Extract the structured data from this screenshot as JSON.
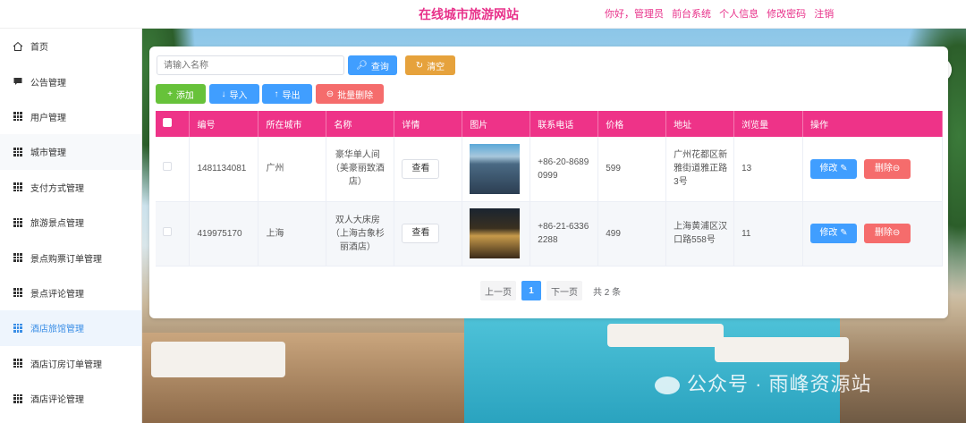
{
  "header": {
    "title": "在线城市旅游网站",
    "greeting": "你好，管理员",
    "links": [
      "前台系统",
      "个人信息",
      "修改密码",
      "注销"
    ]
  },
  "sidebar": {
    "items": [
      {
        "label": "首页",
        "icon": "home-icon"
      },
      {
        "label": "公告管理",
        "icon": "message-icon"
      },
      {
        "label": "用户管理",
        "icon": "grid-icon"
      },
      {
        "label": "城市管理",
        "icon": "grid-icon"
      },
      {
        "label": "支付方式管理",
        "icon": "grid-icon"
      },
      {
        "label": "旅游景点管理",
        "icon": "grid-icon"
      },
      {
        "label": "景点购票订单管理",
        "icon": "grid-icon"
      },
      {
        "label": "景点评论管理",
        "icon": "grid-icon"
      },
      {
        "label": "酒店旅馆管理",
        "icon": "grid-icon",
        "active": true
      },
      {
        "label": "酒店订房订单管理",
        "icon": "grid-icon"
      },
      {
        "label": "酒店评论管理",
        "icon": "grid-icon"
      }
    ]
  },
  "search": {
    "placeholder": "请输入名称",
    "query_label": "查询",
    "clear_label": "清空"
  },
  "toolbar": {
    "add_label": "添加",
    "import_label": "导入",
    "export_label": "导出",
    "batch_delete_label": "批量删除"
  },
  "table": {
    "headers": [
      "编号",
      "所在城市",
      "名称",
      "详情",
      "图片",
      "联系电话",
      "价格",
      "地址",
      "浏览量",
      "操作"
    ],
    "rows": [
      {
        "id": "1481134081",
        "city": "广州",
        "name": "豪华单人间（美豪丽致酒店）",
        "detail": "查看",
        "phone": "+86-20-86890999",
        "price": "599",
        "address": "广州花都区新雅街道雅正路3号",
        "views": "13",
        "edit": "修改",
        "delete": "删除"
      },
      {
        "id": "419975170",
        "city": "上海",
        "name": "双人大床房（上海古象杉丽酒店）",
        "detail": "查看",
        "phone": "+86-21-63362288",
        "price": "499",
        "address": "上海黄浦区汉口路558号",
        "views": "11",
        "edit": "修改",
        "delete": "删除"
      }
    ]
  },
  "pagination": {
    "prev": "上一页",
    "current": "1",
    "next": "下一页",
    "total": "共 2 条"
  },
  "watermark": "公众号 · 雨峰资源站",
  "colors": {
    "accent": "#ee3388",
    "primary": "#409eff",
    "success": "#67c23a",
    "warning": "#e6a23c",
    "danger": "#f56c6c"
  }
}
